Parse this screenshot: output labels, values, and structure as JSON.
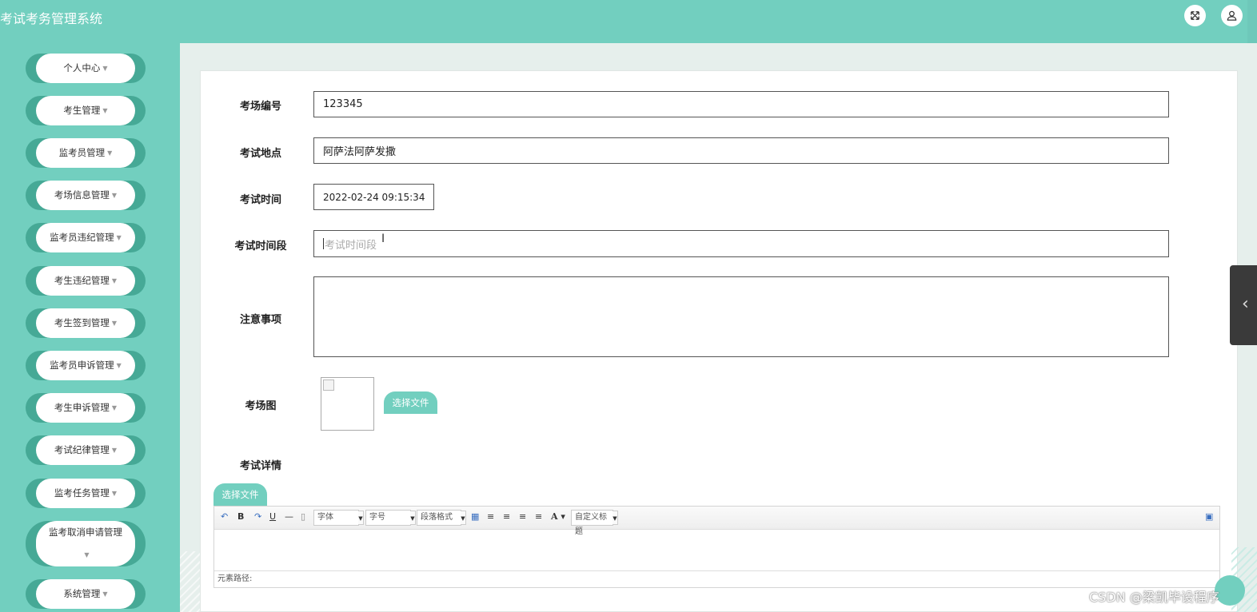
{
  "header": {
    "title": "考试考务管理系统",
    "fullscreen_icon": "fullscreen-icon",
    "user_icon": "user-icon"
  },
  "sidebar": {
    "items": [
      {
        "label": "个人中心"
      },
      {
        "label": "考生管理"
      },
      {
        "label": "监考员管理"
      },
      {
        "label": "考场信息管理"
      },
      {
        "label": "监考员违纪管理"
      },
      {
        "label": "考生违纪管理"
      },
      {
        "label": "考生签到管理"
      },
      {
        "label": "监考员申诉管理"
      },
      {
        "label": "考生申诉管理"
      },
      {
        "label": "考试纪律管理"
      },
      {
        "label": "监考任务管理"
      },
      {
        "label": "监考取消申请管理"
      },
      {
        "label": "系统管理"
      }
    ]
  },
  "form": {
    "exam_room_no": {
      "label": "考场编号",
      "value": "123345"
    },
    "exam_location": {
      "label": "考试地点",
      "value": "阿萨法阿萨发撒"
    },
    "exam_time": {
      "label": "考试时间",
      "value": "2022-02-24 09:15:34"
    },
    "exam_period": {
      "label": "考试时间段",
      "placeholder": "考试时间段"
    },
    "notes": {
      "label": "注意事项",
      "value": ""
    },
    "room_image": {
      "label": "考场图",
      "button": "选择文件"
    },
    "exam_details": {
      "label": "考试详情",
      "button": "选择文件"
    }
  },
  "editor": {
    "font_select": "字体",
    "size_select": "字号",
    "paragraph_select": "段落格式",
    "custom_title_select": "自定义标题",
    "path_label": "元素路径:"
  },
  "watermark": "CSDN @梁凯毕设程序",
  "colors": {
    "accent": "#72cfbf",
    "sidebar_shadow": "#46a996"
  }
}
